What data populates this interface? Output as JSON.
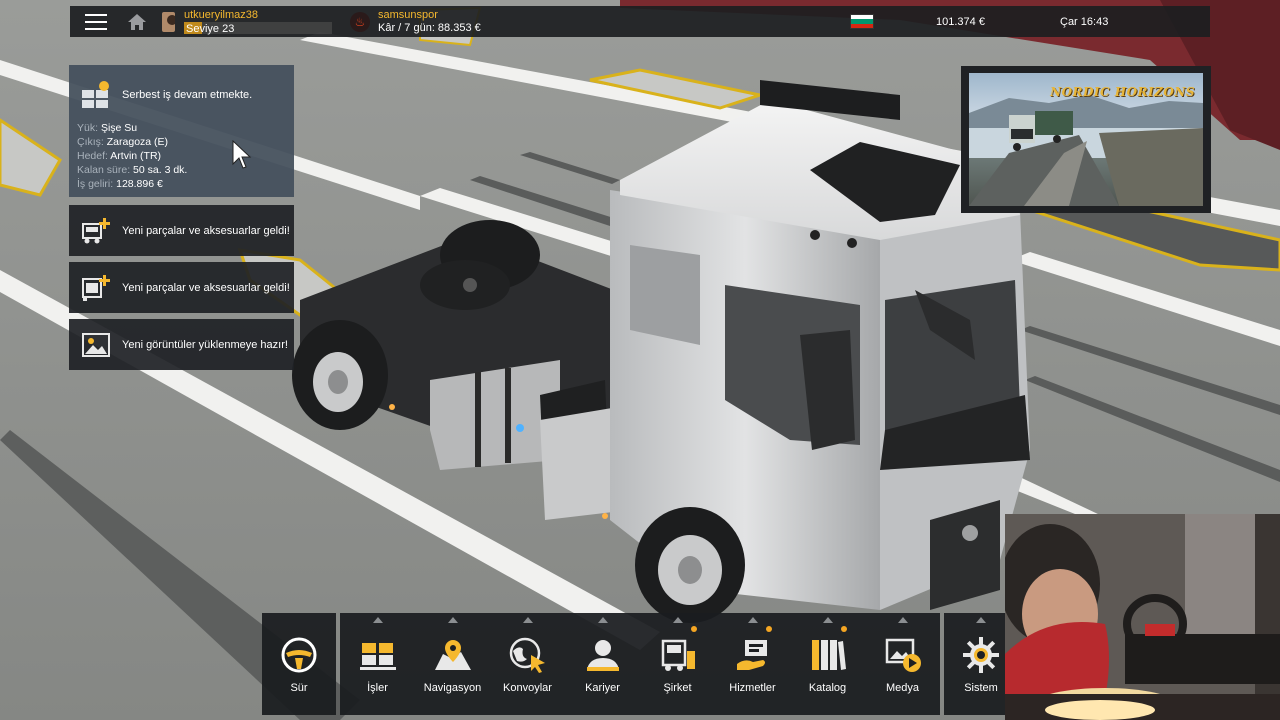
{
  "topbar": {
    "menu_icon": "hamburger-icon",
    "home_icon": "home-icon",
    "username": "utkueryilmaz38",
    "level_label": "Seviye 23",
    "level_progress": 0.12,
    "company_name": "samsunspor",
    "company_profit": "Kâr / 7 gün: 88.353 €",
    "money": "101.374 €",
    "clock": "Çar 16:43",
    "flag_colors": [
      "#ffffff",
      "#00966e",
      "#d62612"
    ]
  },
  "job_panel": {
    "title": "Serbest iş devam etmekte.",
    "details": [
      {
        "key": "Yük:",
        "value": "Şişe Su"
      },
      {
        "key": "Çıkış:",
        "value": "Zaragoza (E)"
      },
      {
        "key": "Hedef:",
        "value": "Artvin (TR)"
      },
      {
        "key": "Kalan süre:",
        "value": "50 sa. 3 dk."
      },
      {
        "key": "İş geliri:",
        "value": "128.896 €"
      }
    ]
  },
  "notifications": [
    {
      "icon": "truck-parts-plus-icon",
      "text": "Yeni parçalar ve aksesuarlar geldi!"
    },
    {
      "icon": "trailer-parts-plus-icon",
      "text": "Yeni parçalar ve aksesuarlar geldi!"
    },
    {
      "icon": "image-icon",
      "text": "Yeni görüntüler yüklenmeye hazır!"
    }
  ],
  "preview": {
    "title": "NORDIC HORIZONS"
  },
  "bottom_menu": {
    "drive": {
      "label": "Sür",
      "icon": "steering-wheel-icon"
    },
    "items": [
      {
        "label": "İşler",
        "icon": "cargo-icon",
        "dot": false
      },
      {
        "label": "Navigasyon",
        "icon": "map-pin-icon",
        "dot": false
      },
      {
        "label": "Konvoylar",
        "icon": "globe-cursor-icon",
        "dot": false
      },
      {
        "label": "Kariyer",
        "icon": "person-icon",
        "dot": false
      },
      {
        "label": "Şirket",
        "icon": "company-truck-icon",
        "dot": true
      },
      {
        "label": "Hizmetler",
        "icon": "services-icon",
        "dot": true
      },
      {
        "label": "Katalog",
        "icon": "catalog-icon",
        "dot": true
      },
      {
        "label": "Medya",
        "icon": "media-icon",
        "dot": false
      }
    ],
    "system": {
      "label": "Sistem",
      "icon": "gear-icon"
    }
  },
  "colors": {
    "accent": "#f5b82e",
    "notification_dot": "#f5a623",
    "job_panel_bg": "#44505c"
  }
}
